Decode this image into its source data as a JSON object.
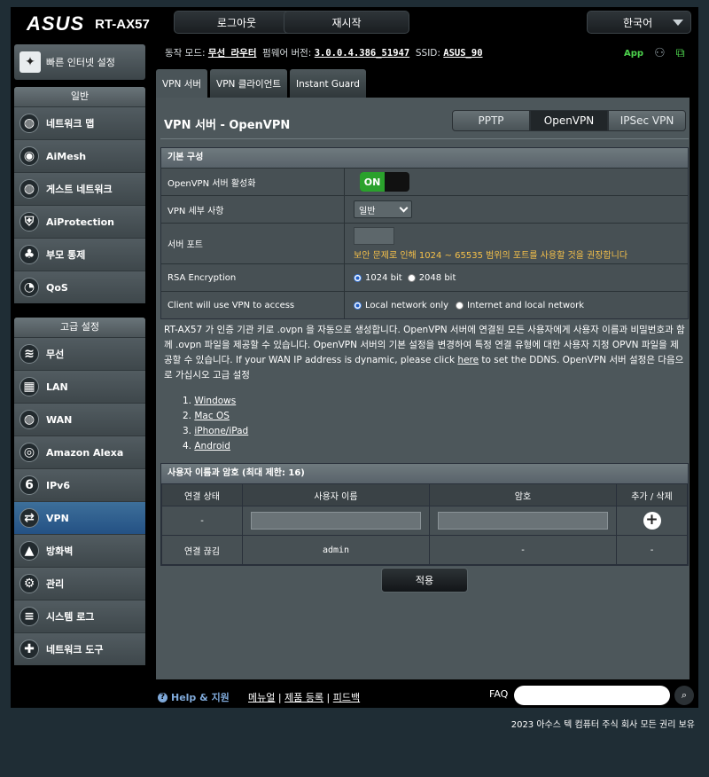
{
  "brand": "ASUS",
  "model": "RT-AX57",
  "topbar": {
    "logout": "로그아웃",
    "reboot": "재시작",
    "language": "한국어"
  },
  "quick_internet": "빠른 인터넷 설정",
  "menu_general": {
    "header": "일반",
    "items": [
      "네트워크 맵",
      "AiMesh",
      "게스트 네트워크",
      "AiProtection",
      "부모 통제",
      "QoS"
    ]
  },
  "menu_advanced": {
    "header": "고급 설정",
    "items": [
      "무선",
      "LAN",
      "WAN",
      "Amazon Alexa",
      "IPv6",
      "VPN",
      "방화벽",
      "관리",
      "시스템 로그",
      "네트워크 도구"
    ]
  },
  "status": {
    "mode_label": "동작 모드:",
    "mode": "무선 라우터",
    "fw_label": "펌웨어 버전:",
    "fw": "3.0.0.4.386_51947",
    "ssid_label": "SSID:",
    "ssid": "ASUS_90",
    "app": "App"
  },
  "tabs": [
    "VPN 서버",
    "VPN 클라이언트",
    "Instant Guard"
  ],
  "page_title": "VPN 서버 - OpenVPN",
  "vpn_types": [
    "PPTP",
    "OpenVPN",
    "IPSec VPN"
  ],
  "basic": {
    "header": "기본 구성",
    "enable_label": "OpenVPN 서버 활성화",
    "enable_value": "ON",
    "detail_label": "VPN 세부 사항",
    "detail_value": "일반",
    "port_label": "서버 포트",
    "port_warning": "보안 문제로 인해 1024 ~ 65535 범위의 포트를 사용할 것을 권장합니다",
    "rsa_label": "RSA Encryption",
    "rsa_opt1": "1024 bit",
    "rsa_opt2": "2048 bit",
    "access_label": "Client will use VPN to access",
    "access_opt1": "Local network only",
    "access_opt2": "Internet and local network"
  },
  "desc": {
    "part1": "RT-AX57 가 인증 기관 키로 .ovpn 을 자동으로 생성합니다. OpenVPN 서버에 연결된 모든 사용자에게 사용자 이름과 비밀번호과 함께 .ovpn 파일을 제공할 수 있습니다. OpenVPN 서버의 기본 설정을 변경하여 특정 연결 유형에 대한 사용자 지정 OPVN 파일을 제공할 수 있습니다. If your WAN IP address is dynamic, please click ",
    "link": "here",
    "part2": " to set the DDNS. OpenVPN 서버 설정은 다음으로 가십시오 고급 설정"
  },
  "platforms": [
    "Windows",
    "Mac OS",
    "iPhone/iPad",
    "Android"
  ],
  "users": {
    "header": "사용자 이름과 암호 (최대 제한: 16)",
    "cols": [
      "연결 상태",
      "사용자 이름",
      "암호",
      "추가 / 삭제"
    ],
    "new_status": "-",
    "row": {
      "status": "연결 끊김",
      "user": "admin",
      "pwd": "-",
      "action": "-"
    }
  },
  "apply": "적용",
  "footer": {
    "help": "Help & 지원",
    "manual": "메뉴얼",
    "register": "제품 등록",
    "feedback": "피드백",
    "faq": "FAQ",
    "copyright": "2023 아수스 텍 컴퓨터 주식 회사 모든 권리 보유"
  }
}
